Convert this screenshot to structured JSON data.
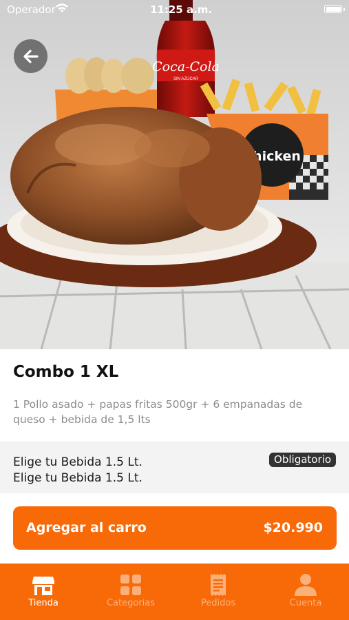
{
  "status_bar": {
    "carrier": "Operador",
    "time": "11:25 a.m."
  },
  "product": {
    "title": "Combo 1 XL",
    "description": "1 Pollo asado + papas fritas 500gr + 6 empanadas de queso + bebida de 1,5 lts"
  },
  "options": {
    "line1": "Elige tu Bebida 1.5 Lt.",
    "line2": "Elige tu Bebida 1.5 Lt.",
    "badge": "Obligatorio"
  },
  "cart": {
    "label": "Agregar al carro",
    "price": "$20.990"
  },
  "tabs": [
    {
      "label": "Tienda",
      "icon": "store-icon",
      "active": true
    },
    {
      "label": "Categorias",
      "icon": "grid-icon",
      "active": false
    },
    {
      "label": "Pedidos",
      "icon": "receipt-icon",
      "active": false
    },
    {
      "label": "Cuenta",
      "icon": "user-icon",
      "active": false
    }
  ],
  "hero": {
    "bottle_brand": "Coca-Cola",
    "bottle_sub": "SIN AZÚCAR",
    "box_brand": "Chicken"
  },
  "colors": {
    "accent": "#f86a08",
    "badge": "#333333",
    "options_bg": "#f3f3f3"
  }
}
